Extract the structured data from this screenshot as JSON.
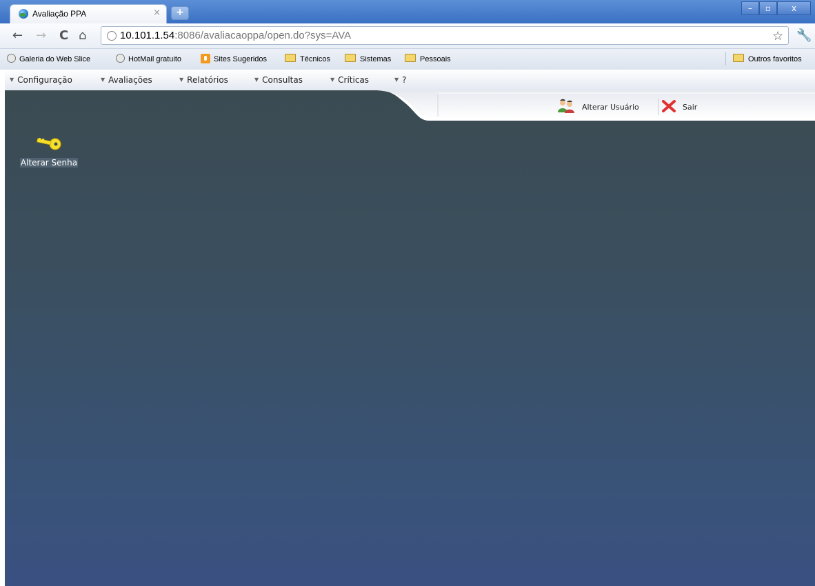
{
  "browser": {
    "tab_title": "Avaliação PPA",
    "tab_close": "×",
    "new_tab": "+",
    "window_controls": {
      "minimize": "–",
      "maximize": "▫",
      "close": "x"
    },
    "url_host": "10.101.1.54",
    "url_rest": ":8086/avaliacaoppa/open.do?sys=AVA"
  },
  "bookmarks": {
    "items": [
      {
        "label": "Galeria do Web Slice",
        "icon": "globe-icon"
      },
      {
        "label": "HotMail gratuito",
        "icon": "globe-icon"
      },
      {
        "label": "Sites Sugeridos",
        "icon": "suggested-sites-icon"
      },
      {
        "label": "Técnicos",
        "icon": "folder-icon"
      },
      {
        "label": "Sistemas",
        "icon": "folder-icon"
      },
      {
        "label": "Pessoais",
        "icon": "folder-icon"
      }
    ],
    "other": "Outros favoritos"
  },
  "app_menu": {
    "items": [
      {
        "label": "Configuração"
      },
      {
        "label": "Avaliações"
      },
      {
        "label": "Relatórios"
      },
      {
        "label": "Consultas"
      },
      {
        "label": "Críticas"
      },
      {
        "label": "?"
      }
    ]
  },
  "user_bar": {
    "change_user": "Alterar Usuário",
    "logout": "Sair"
  },
  "desktop": {
    "change_password": "Alterar Senha"
  },
  "colors": {
    "content_top": "#3b4b52",
    "content_bottom": "#3a5081",
    "titlebar": "#3a70c4"
  }
}
